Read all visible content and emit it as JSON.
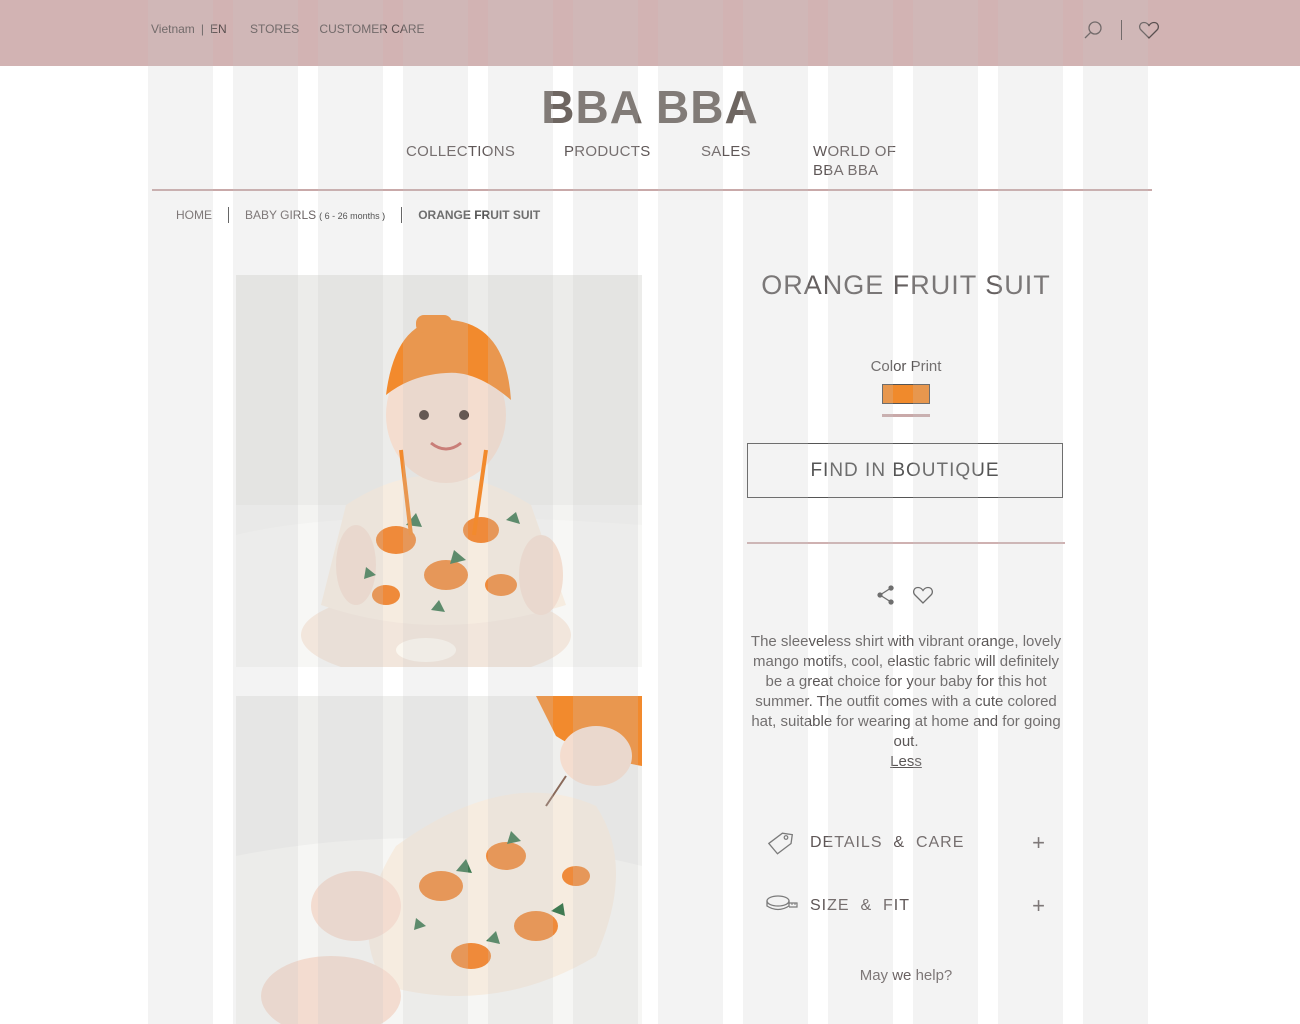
{
  "topbar": {
    "country": "Vietnam",
    "separator": "|",
    "language": "EN",
    "stores": "STORES",
    "customer_care": "CUSTOMER CARE",
    "icons": [
      "search-icon",
      "heart-icon"
    ]
  },
  "logo": "BBA BBA",
  "nav": {
    "collections": "COLLECTIONS",
    "products": "PRODUCTS",
    "sales": "SALES",
    "world": "WORLD OF BBA BBA"
  },
  "breadcrumb": {
    "home": "HOME",
    "category": "BABY GIRLS",
    "category_age": "( 6 - 26 months )",
    "current": "ORANGE FRUIT SUIT"
  },
  "product": {
    "title": "ORANGE FRUIT SUIT",
    "color_label": "Color Print",
    "swatch_color": "#f08a2c",
    "find_button": "FIND IN BOUTIQUE",
    "description": "The sleeveless shirt with vibrant orange, lovely mango motifs, cool, elastic fabric will definitely be a great choice for your baby for this hot summer. The outfit comes with a cute colored hat, suitable for wearing at home and for going out.",
    "less": "Less",
    "accordion": [
      {
        "label": "DETAILS  &  CARE",
        "icon": "price-tag-icon"
      },
      {
        "label": "SIZE  &  FIT",
        "icon": "measuring-tape-icon"
      }
    ],
    "help": "May we help?"
  },
  "colors": {
    "topbar": "#d2b3b3",
    "accent_rule": "#c9a9a9",
    "orange": "#f08a2c"
  }
}
